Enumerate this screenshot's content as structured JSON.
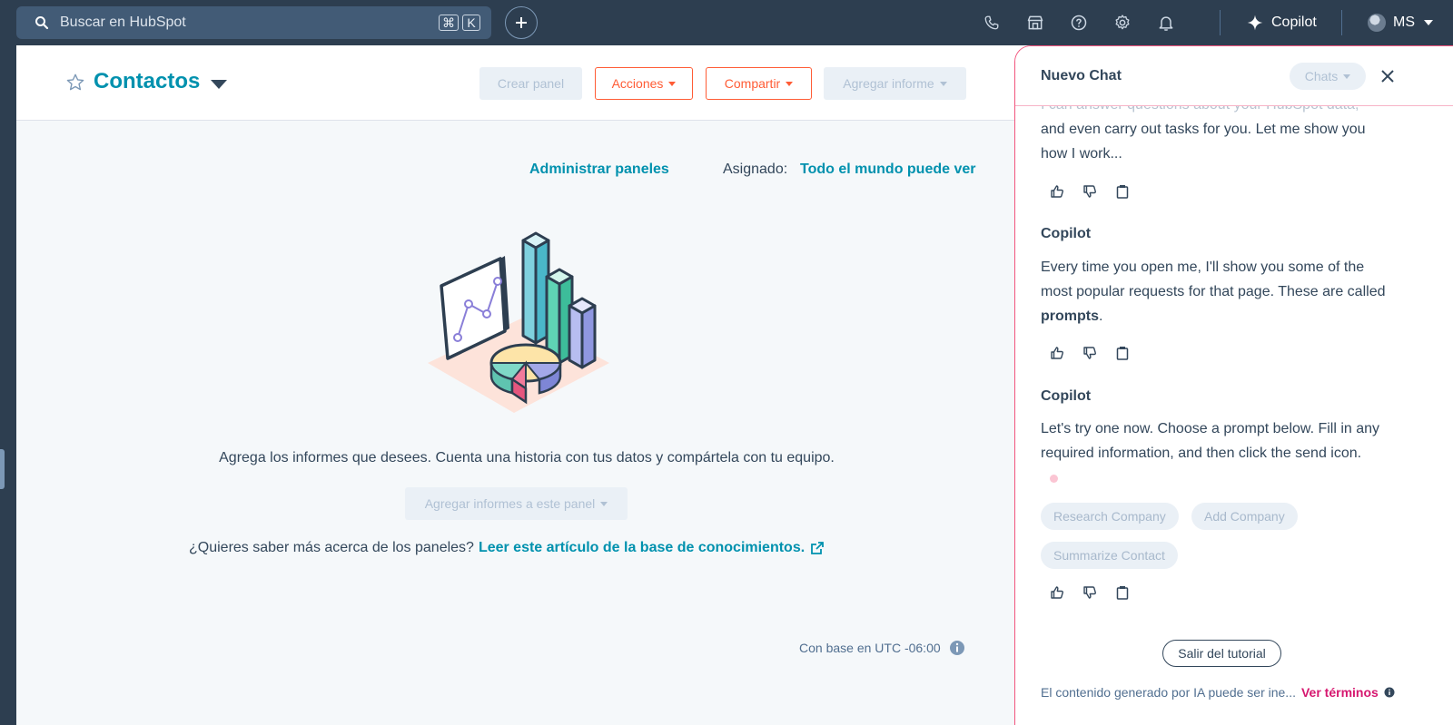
{
  "topnav": {
    "search_placeholder": "Buscar en HubSpot",
    "shortcut_keys": [
      "⌘",
      "K"
    ],
    "copilot_label": "Copilot",
    "account_initials": "MS"
  },
  "header": {
    "title": "Contactos",
    "buttons": {
      "create_dashboard": "Crear panel",
      "actions": "Acciones",
      "share": "Compartir",
      "add_report": "Agregar informe"
    }
  },
  "dashboard": {
    "manage_link": "Administrar paneles",
    "assigned_label": "Asignado:",
    "assigned_value": "Todo el mundo puede ver",
    "empty_text": "Agrega los informes que desees. Cuenta una historia con tus datos y compártela con tu equipo.",
    "add_reports_button": "Agregar informes a este panel",
    "learn_more_prefix": "¿Quieres saber más acerca de los paneles?",
    "learn_more_link": "Leer este artículo de la base de conocimientos.",
    "timezone": "Con base en UTC -06:00"
  },
  "copilot": {
    "title": "Nuevo Chat",
    "chats_label": "Chats",
    "messages": [
      {
        "text_partial_top": "I can answer questions about your HubSpot data,",
        "text": "and even carry out tasks for you. Let me show you how I work..."
      },
      {
        "sender": "Copilot",
        "text": "Every time you open me, I'll show you some of the most popular requests for that page. These are called ",
        "bold": "prompts",
        "suffix": "."
      },
      {
        "sender": "Copilot",
        "text": "Let's try one now. Choose a prompt below. Fill in any required information, and then click the send icon."
      }
    ],
    "prompts": [
      "Research Company",
      "Add Company",
      "Summarize Contact"
    ],
    "exit_tutorial": "Salir del tutorial",
    "disclaimer": "El contenido generado por IA puede ser ine...",
    "terms_link": "Ver términos"
  },
  "colors": {
    "nav_bg": "#2d3e50",
    "link": "#0091ae",
    "accent_orange": "#ff5c35",
    "copilot_pink": "#f2547d",
    "terms_magenta": "#d6176f"
  }
}
